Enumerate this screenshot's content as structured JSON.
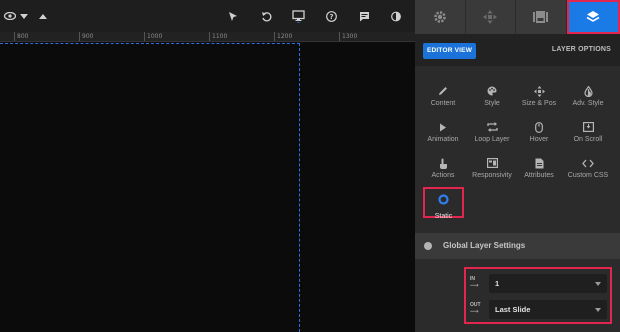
{
  "toolbar": {
    "left_icons": [
      "eye-icon",
      "caret-down-icon",
      "caret-up-icon"
    ],
    "right_icons": [
      "cursor-icon",
      "undo-icon",
      "monitor-icon",
      "help-icon",
      "comment-icon",
      "contrast-icon"
    ]
  },
  "ruler": {
    "ticks": [
      "800",
      "900",
      "1000",
      "1100",
      "1200",
      "1300"
    ]
  },
  "panel": {
    "tabs": [
      {
        "icon": "gear-icon",
        "active": false
      },
      {
        "icon": "move-arrows-icon",
        "active": false
      },
      {
        "icon": "slides-icon",
        "active": false
      },
      {
        "icon": "layers-icon",
        "active": true
      }
    ],
    "editor_view": "EDITOR VIEW",
    "layer_options": "LAYER OPTIONS",
    "options": [
      {
        "label": "Content",
        "icon": "pencil-icon"
      },
      {
        "label": "Style",
        "icon": "palette-icon"
      },
      {
        "label": "Size & Pos",
        "icon": "move-arrows-icon"
      },
      {
        "label": "Adv. Style",
        "icon": "droplet-icon"
      },
      {
        "label": "Animation",
        "icon": "play-icon"
      },
      {
        "label": "Loop Layer",
        "icon": "loop-icon"
      },
      {
        "label": "Hover",
        "icon": "mouse-icon"
      },
      {
        "label": "On Scroll",
        "icon": "scroll-icon"
      },
      {
        "label": "Actions",
        "icon": "hand-pointer-icon"
      },
      {
        "label": "Responsivity",
        "icon": "screen-icon"
      },
      {
        "label": "Attributes",
        "icon": "document-icon"
      },
      {
        "label": "Custom CSS",
        "icon": "code-icon"
      }
    ],
    "static": {
      "label": "Static",
      "icon": "ring-icon"
    },
    "global_settings": {
      "title": "Global Layer Settings",
      "in_tag": "IN",
      "in_value": "1",
      "out_tag": "OUT",
      "out_value": "Last Slide"
    }
  },
  "colors": {
    "accent": "#1a7ae6",
    "highlight": "#e2264f",
    "guide": "#2f6fe0"
  }
}
